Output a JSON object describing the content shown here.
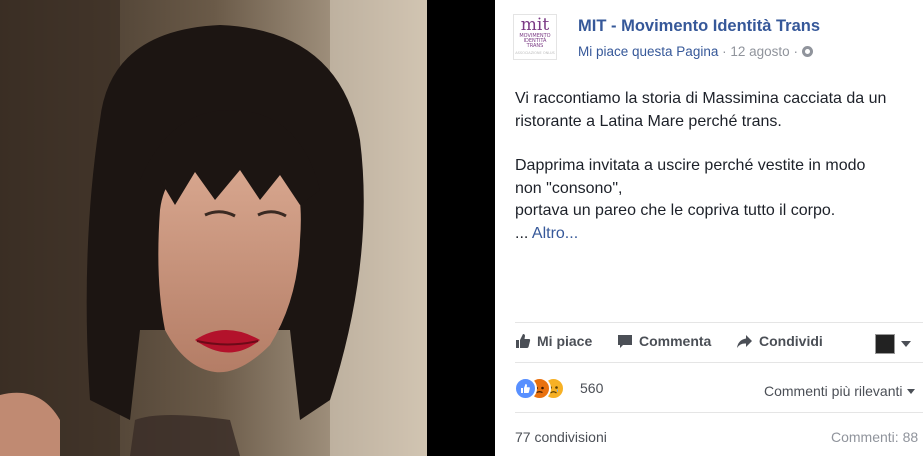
{
  "post": {
    "page_name": "MIT - Movimento Identità Trans",
    "like_page": "Mi piace questa Pagina",
    "sep1": "·",
    "date": "12 agosto",
    "sep2": "·",
    "logo": {
      "mark": "mit",
      "line1": "MOVIMENTO",
      "line2": "IDENTITÀ",
      "line3": "TRANS",
      "line4": "ASSOCIAZIONE ONLUS"
    },
    "text": {
      "line1": "Vi raccontiamo la storia di Massimina cacciata da un",
      "line2": "ristorante a Latina Mare perché trans.",
      "line3": "Dapprima invitata a uscire perché vestite in modo",
      "line4": "non \"consono\",",
      "line5": "portava un pareo che le copriva tutto il corpo.",
      "ellipsis": "... ",
      "more": "Altro..."
    }
  },
  "actions": {
    "like": "Mi piace",
    "comment": "Commenta",
    "share": "Condividi"
  },
  "stats": {
    "reactions_count": "560",
    "reactions": [
      "like",
      "angry",
      "sad"
    ],
    "sort": "Commenti più rilevanti",
    "shares": "77 condivisioni",
    "comments": "Commenti: 88"
  },
  "colors": {
    "link": "#365899",
    "text": "#1d2129",
    "muted": "#90949c",
    "like_blue": "#5890ff"
  }
}
